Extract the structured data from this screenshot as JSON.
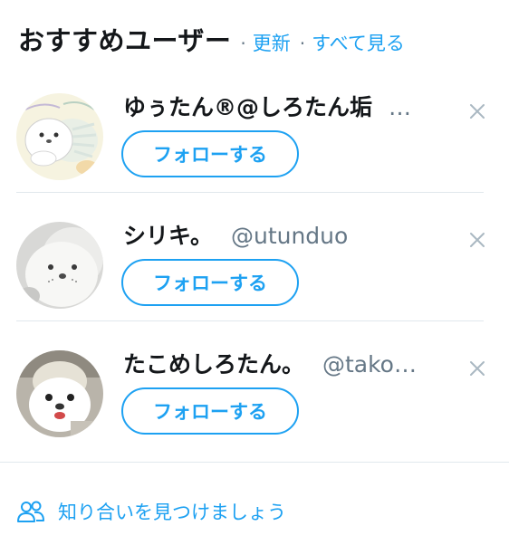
{
  "header": {
    "title": "おすすめユーザー",
    "separator": "·",
    "refresh_label": "更新",
    "view_all_label": "すべて見る"
  },
  "users": [
    {
      "name": "ゆぅたん®@しろたん垢",
      "handle": "",
      "truncated": "…",
      "follow_label": "フォローする",
      "dismiss_icon": "close-icon"
    },
    {
      "name": "シリキ。",
      "handle": "@utunduo",
      "truncated": "",
      "follow_label": "フォローする",
      "dismiss_icon": "close-icon"
    },
    {
      "name": "たこめしろたん。",
      "handle": "@tako",
      "truncated": "…",
      "follow_label": "フォローする",
      "dismiss_icon": "close-icon"
    }
  ],
  "footer": {
    "icon": "people-icon",
    "label": "知り合いを見つけましょう"
  },
  "colors": {
    "accent": "#1da1f2",
    "text": "#14171a",
    "secondary": "#657786",
    "divider": "#e1e8ed"
  }
}
